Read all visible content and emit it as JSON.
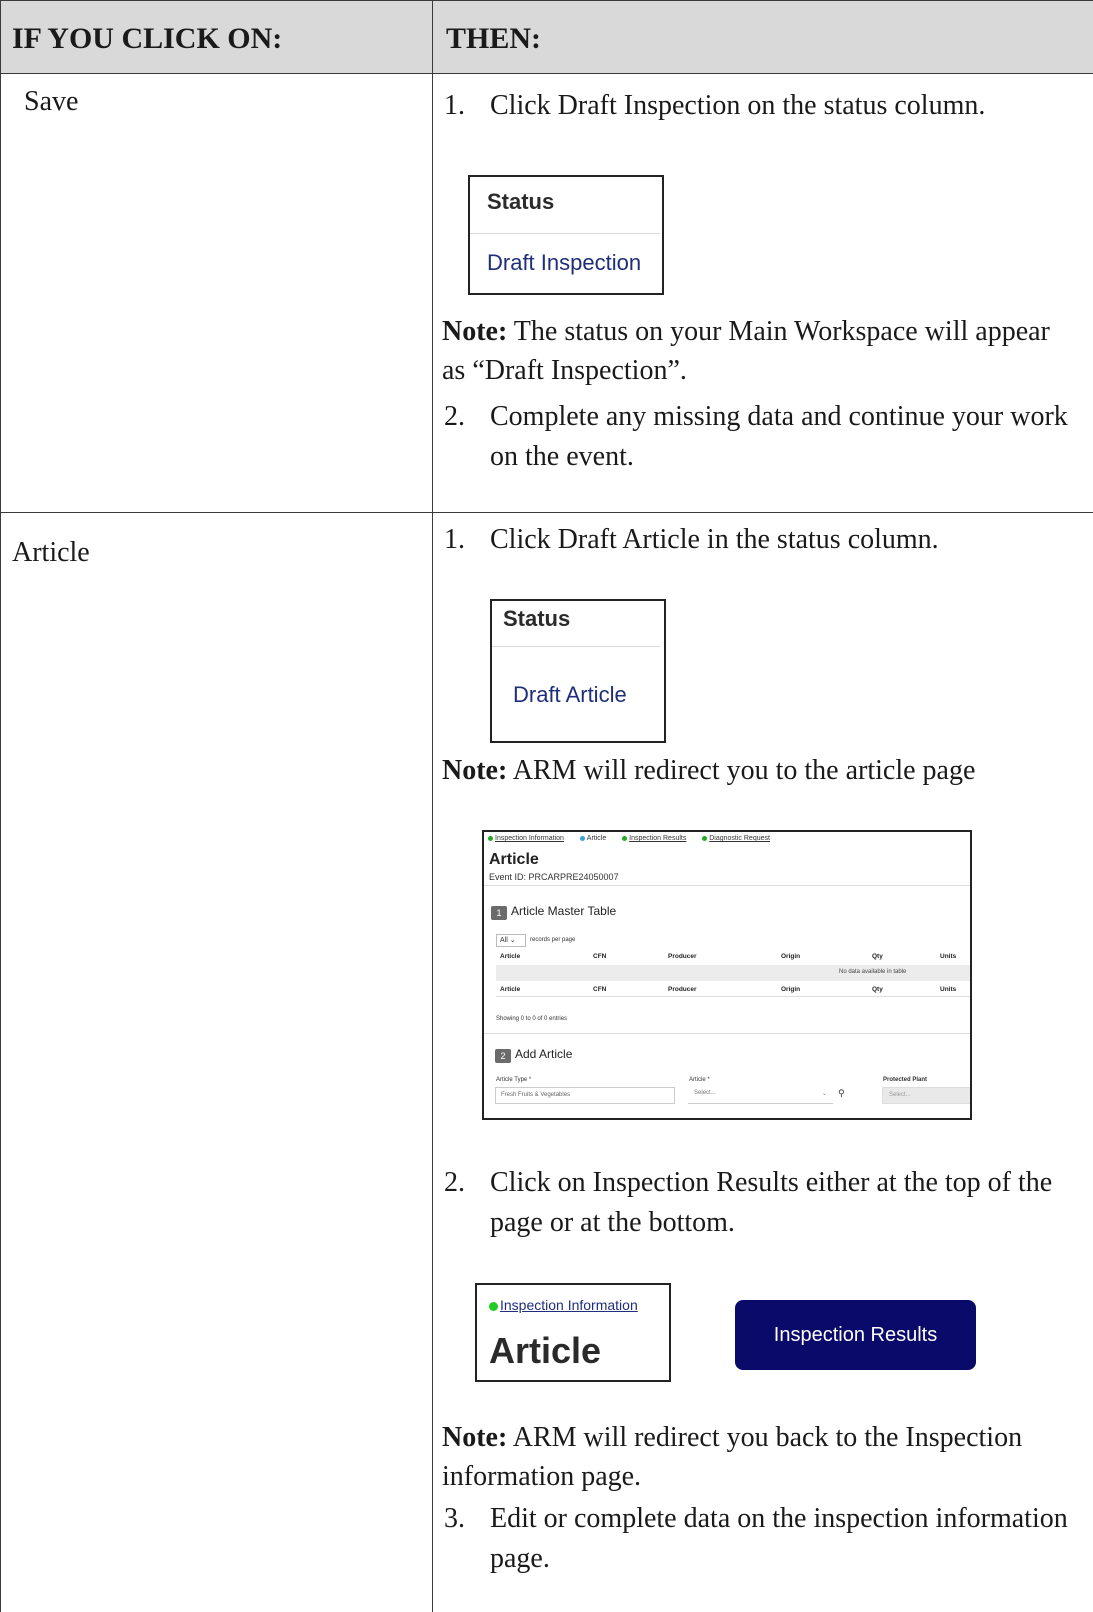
{
  "header": {
    "col1": "IF YOU CLICK ON:",
    "col2": "THEN:"
  },
  "row1": {
    "option": "Save",
    "step1_num": "1.",
    "step1": "Click Draft Inspection on the status column.",
    "status_box": {
      "heading": "Status",
      "value": "Draft Inspection"
    },
    "note_label": "Note:",
    "note_text": " The status on your Main Workspace will appear as “Draft Inspection”.",
    "step2_num": "2.",
    "step2": "Complete any missing data and continue your work on the event."
  },
  "row2": {
    "option": "Article",
    "step1_num": "1.",
    "step1": "Click Draft Article in the status column.",
    "status_box": {
      "heading": "Status",
      "value": "Draft Article"
    },
    "note1_label": "Note:",
    "note1_text": " ARM will redirect you to the article page",
    "screenshot": {
      "tabs": [
        "Inspection Information",
        "Article",
        "Inspection Results",
        "Diagnostic Request"
      ],
      "tab_colors": [
        "#22aa22",
        "#3aa0d8",
        "#22aa22",
        "#22aa22"
      ],
      "title": "Article",
      "event_id": "Event ID: PRCARPRE24050007",
      "section1_num": "1",
      "section1": "Article Master Table",
      "records_select": "All",
      "records_label": "records per page",
      "columns": [
        "Article",
        "CFN",
        "Producer",
        "Origin",
        "Qty",
        "Units"
      ],
      "empty_text": "No data available in table",
      "showing": "Showing 0 to 0 of 0 entries",
      "section2_num": "2",
      "section2": "Add Article",
      "field1_label": "Article Type *",
      "field1_value": "Fresh Fruits & Vegetables",
      "field2_label": "Article *",
      "field2_value": "Select...",
      "field3_label": "Protected Plant",
      "field3_value": "Select..."
    },
    "step2_num": "2.",
    "step2": "Click on Inspection Results either at the top of the page or at the bottom.",
    "crop_link": "Inspection Information",
    "crop_title": "Article",
    "button_label": "Inspection Results",
    "note2_label": "Note:",
    "note2_text": " ARM will redirect you back to the Inspection information page.",
    "step3_num": "3.",
    "step3": "Edit or complete data on the inspection information page."
  }
}
